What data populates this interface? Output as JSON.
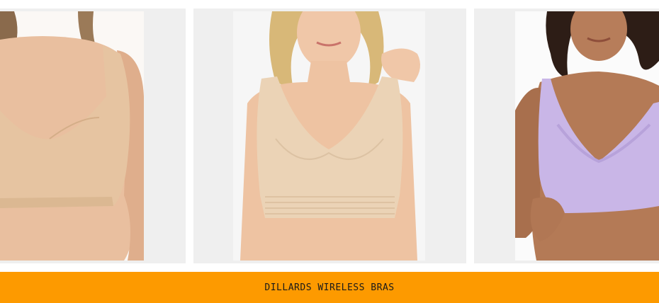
{
  "gallery": {
    "items": [
      {
        "alt": "nude-wireless-bra-photo"
      },
      {
        "alt": "beige-wireless-bra-photo"
      },
      {
        "alt": "lavender-wireless-bra-photo"
      }
    ]
  },
  "banner": {
    "label": "DILLARDS WIRELESS BRAS",
    "background": "#fd9a00"
  },
  "colors": {
    "skin": "#e9bf9f",
    "nude": "#e8c8a6",
    "lavender": "#c8b6e6",
    "tile_bg": "#efefef"
  }
}
